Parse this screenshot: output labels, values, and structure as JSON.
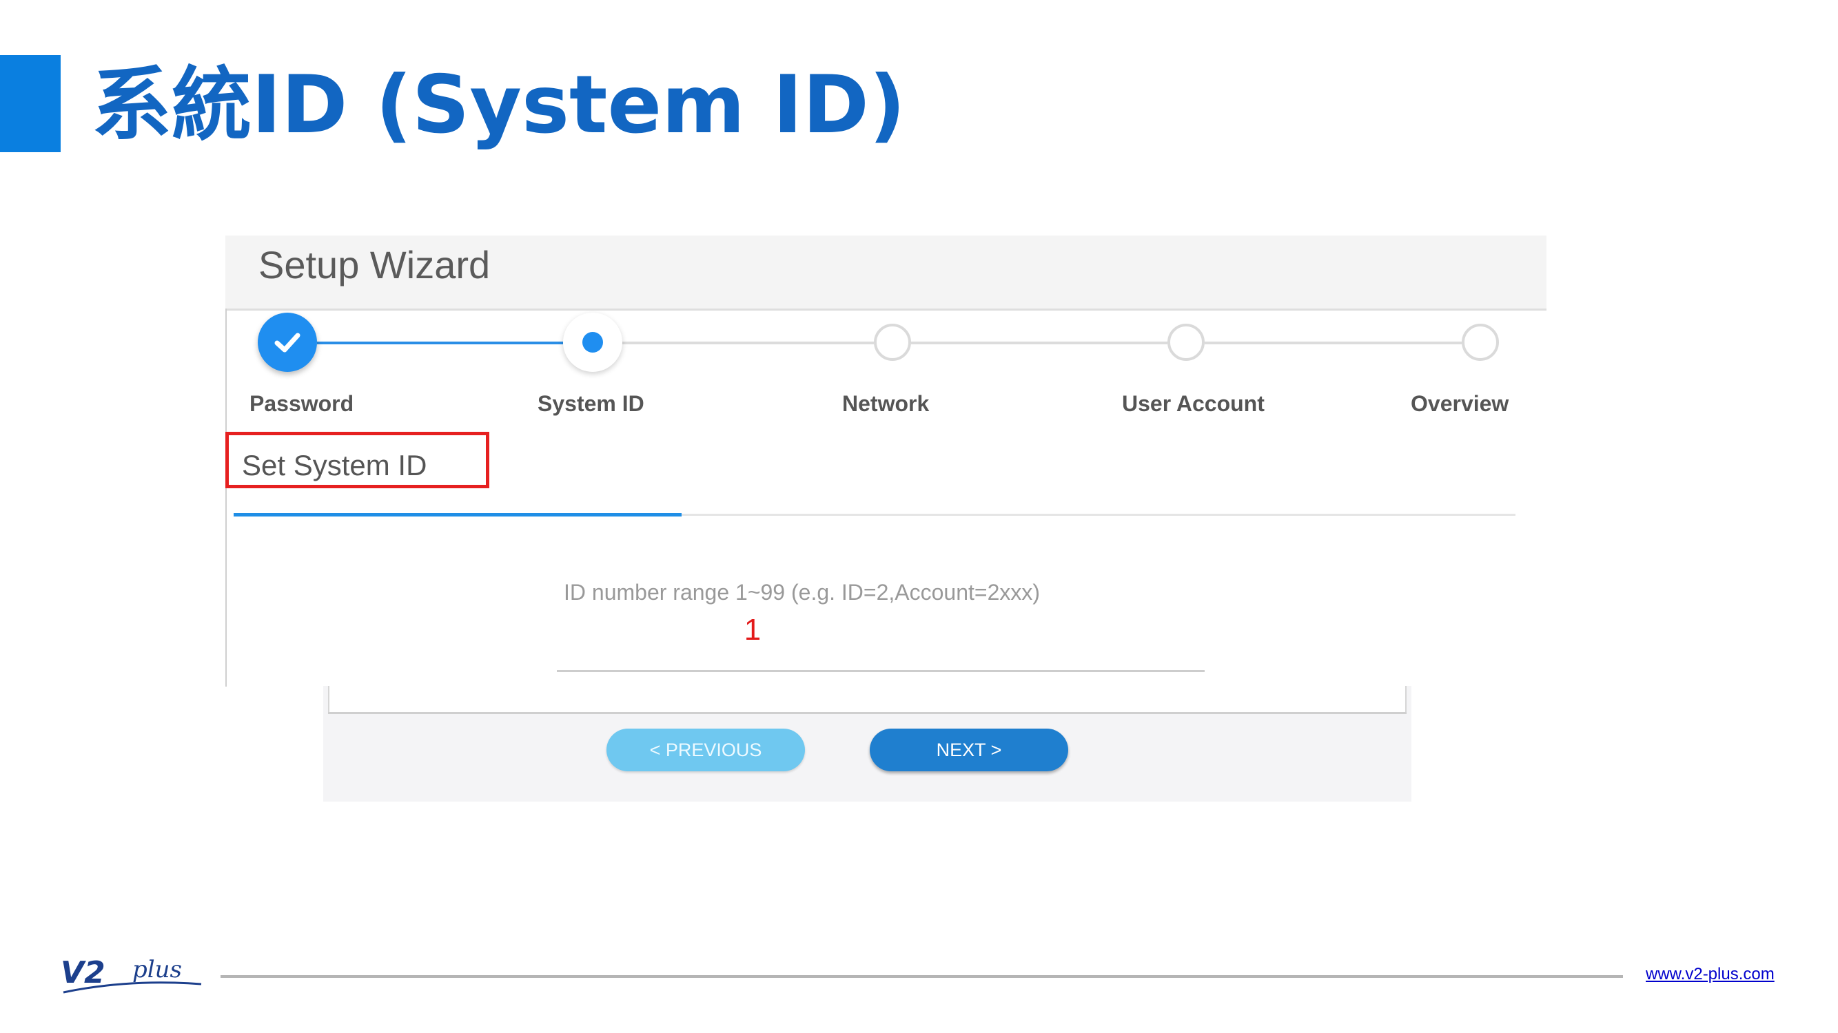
{
  "slide": {
    "title": "系統ID (System ID)",
    "website": "www.v2-plus.com",
    "logo_text": "V2plus",
    "accent_color": "#0a7fe0",
    "title_color": "#1266c2"
  },
  "wizard": {
    "title": "Setup Wizard",
    "steps": [
      {
        "label": "Password",
        "state": "completed"
      },
      {
        "label": "System ID",
        "state": "active"
      },
      {
        "label": "Network",
        "state": "pending"
      },
      {
        "label": "User Account",
        "state": "pending"
      },
      {
        "label": "Overview",
        "state": "pending"
      }
    ],
    "section_title": "Set System ID",
    "field": {
      "label": "ID number range 1~99 (e.g. ID=2,Account=2xxx)",
      "value": "1"
    },
    "buttons": {
      "previous": "< PREVIOUS",
      "next": "NEXT >"
    },
    "highlight_color": "#e62020",
    "primary_color": "#1f8ef0"
  }
}
